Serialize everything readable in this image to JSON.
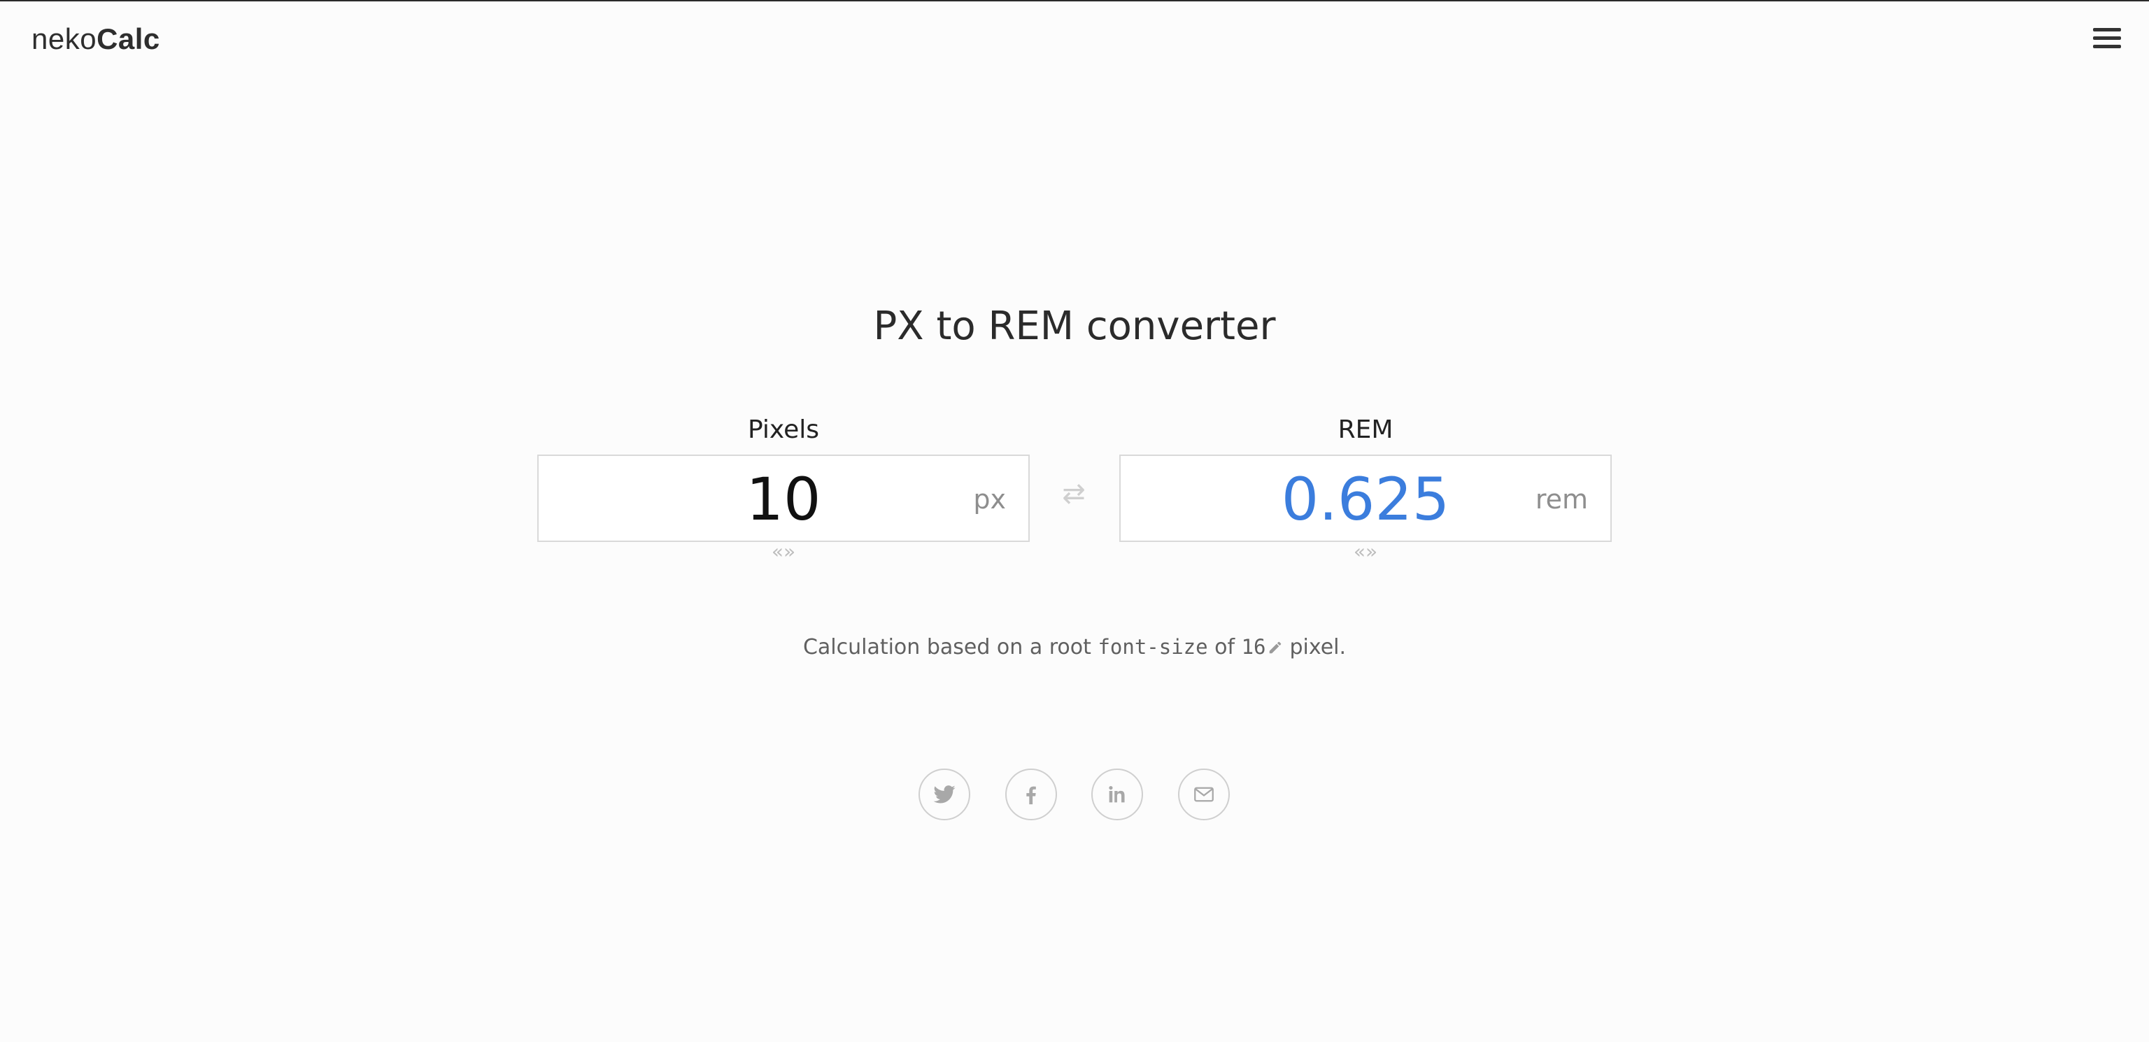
{
  "header": {
    "logo_light": "neko",
    "logo_bold": "Calc",
    "menu_icon": "hamburger-menu-icon"
  },
  "main": {
    "title": "PX to REM converter",
    "pixels": {
      "label": "Pixels",
      "value": "10",
      "unit": "px",
      "resize_glyph": "«»"
    },
    "rem": {
      "label": "REM",
      "value": "0.625",
      "unit": "rem",
      "resize_glyph": "«»"
    },
    "swap_glyph": "⇄",
    "note": {
      "prefix": "Calculation based on a root ",
      "code": "font-size",
      "middle": " of ",
      "root_size": "16",
      "suffix": "pixel."
    }
  },
  "share": {
    "icons": [
      "twitter-icon",
      "facebook-icon",
      "linkedin-icon",
      "email-icon"
    ]
  },
  "colors": {
    "background": "#fcfcfc",
    "result_blue": "#3b7ddd",
    "border": "#d9d9d9",
    "muted": "#8e8e8e"
  }
}
